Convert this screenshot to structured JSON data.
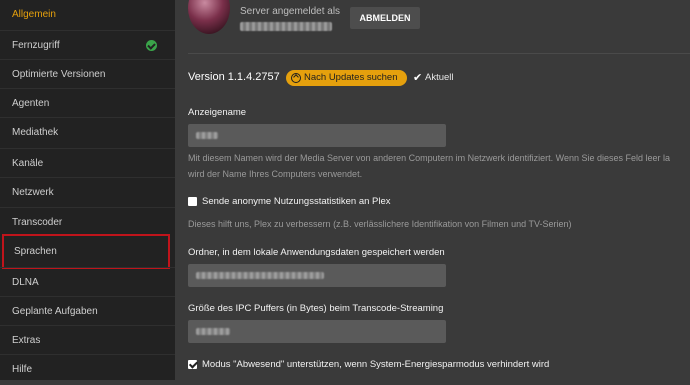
{
  "sidebar": {
    "items": [
      {
        "label": "Allgemein"
      },
      {
        "label": "Fernzugriff"
      },
      {
        "label": "Optimierte Versionen"
      },
      {
        "label": "Agenten"
      },
      {
        "label": "Mediathek"
      },
      {
        "label": "Kanäle"
      },
      {
        "label": "Netzwerk"
      },
      {
        "label": "Transcoder"
      },
      {
        "label": "Sprachen"
      },
      {
        "label": "DLNA"
      },
      {
        "label": "Geplante Aufgaben"
      },
      {
        "label": "Extras"
      },
      {
        "label": "Hilfe"
      }
    ]
  },
  "account": {
    "signed_in_label": "Server angemeldet als",
    "logout_label": "ABMELDEN"
  },
  "version": {
    "text": "Version 1.1.4.2757",
    "update_button": "Nach Updates suchen",
    "status": "Aktuell"
  },
  "friendly_name": {
    "label": "Anzeigename",
    "help_line1": "Mit diesem Namen wird der Media Server von anderen Computern im Netzwerk identifiziert. Wenn Sie dieses Feld leer la",
    "help_line2": "wird der Name Ihres Computers verwendet."
  },
  "usage_stats": {
    "label": "Sende anonyme Nutzungsstatistiken an Plex",
    "help": "Dieses hilft uns, Plex zu verbessern (z.B. verlässlichere Identifikation von Filmen und TV-Serien)"
  },
  "data_folder": {
    "label": "Ordner, in dem lokale Anwendungsdaten gespeichert werden"
  },
  "ipc_buffer": {
    "label": "Größe des IPC Puffers (in Bytes) beim Transcode-Streaming"
  },
  "away_mode": {
    "label": "Modus \"Abwesend\" unterstützen, wenn System-Energiesparmodus verhindert wird"
  },
  "colors": {
    "accent": "#e5a00d",
    "highlight_border": "#c0141b",
    "success": "#3aa54a"
  }
}
